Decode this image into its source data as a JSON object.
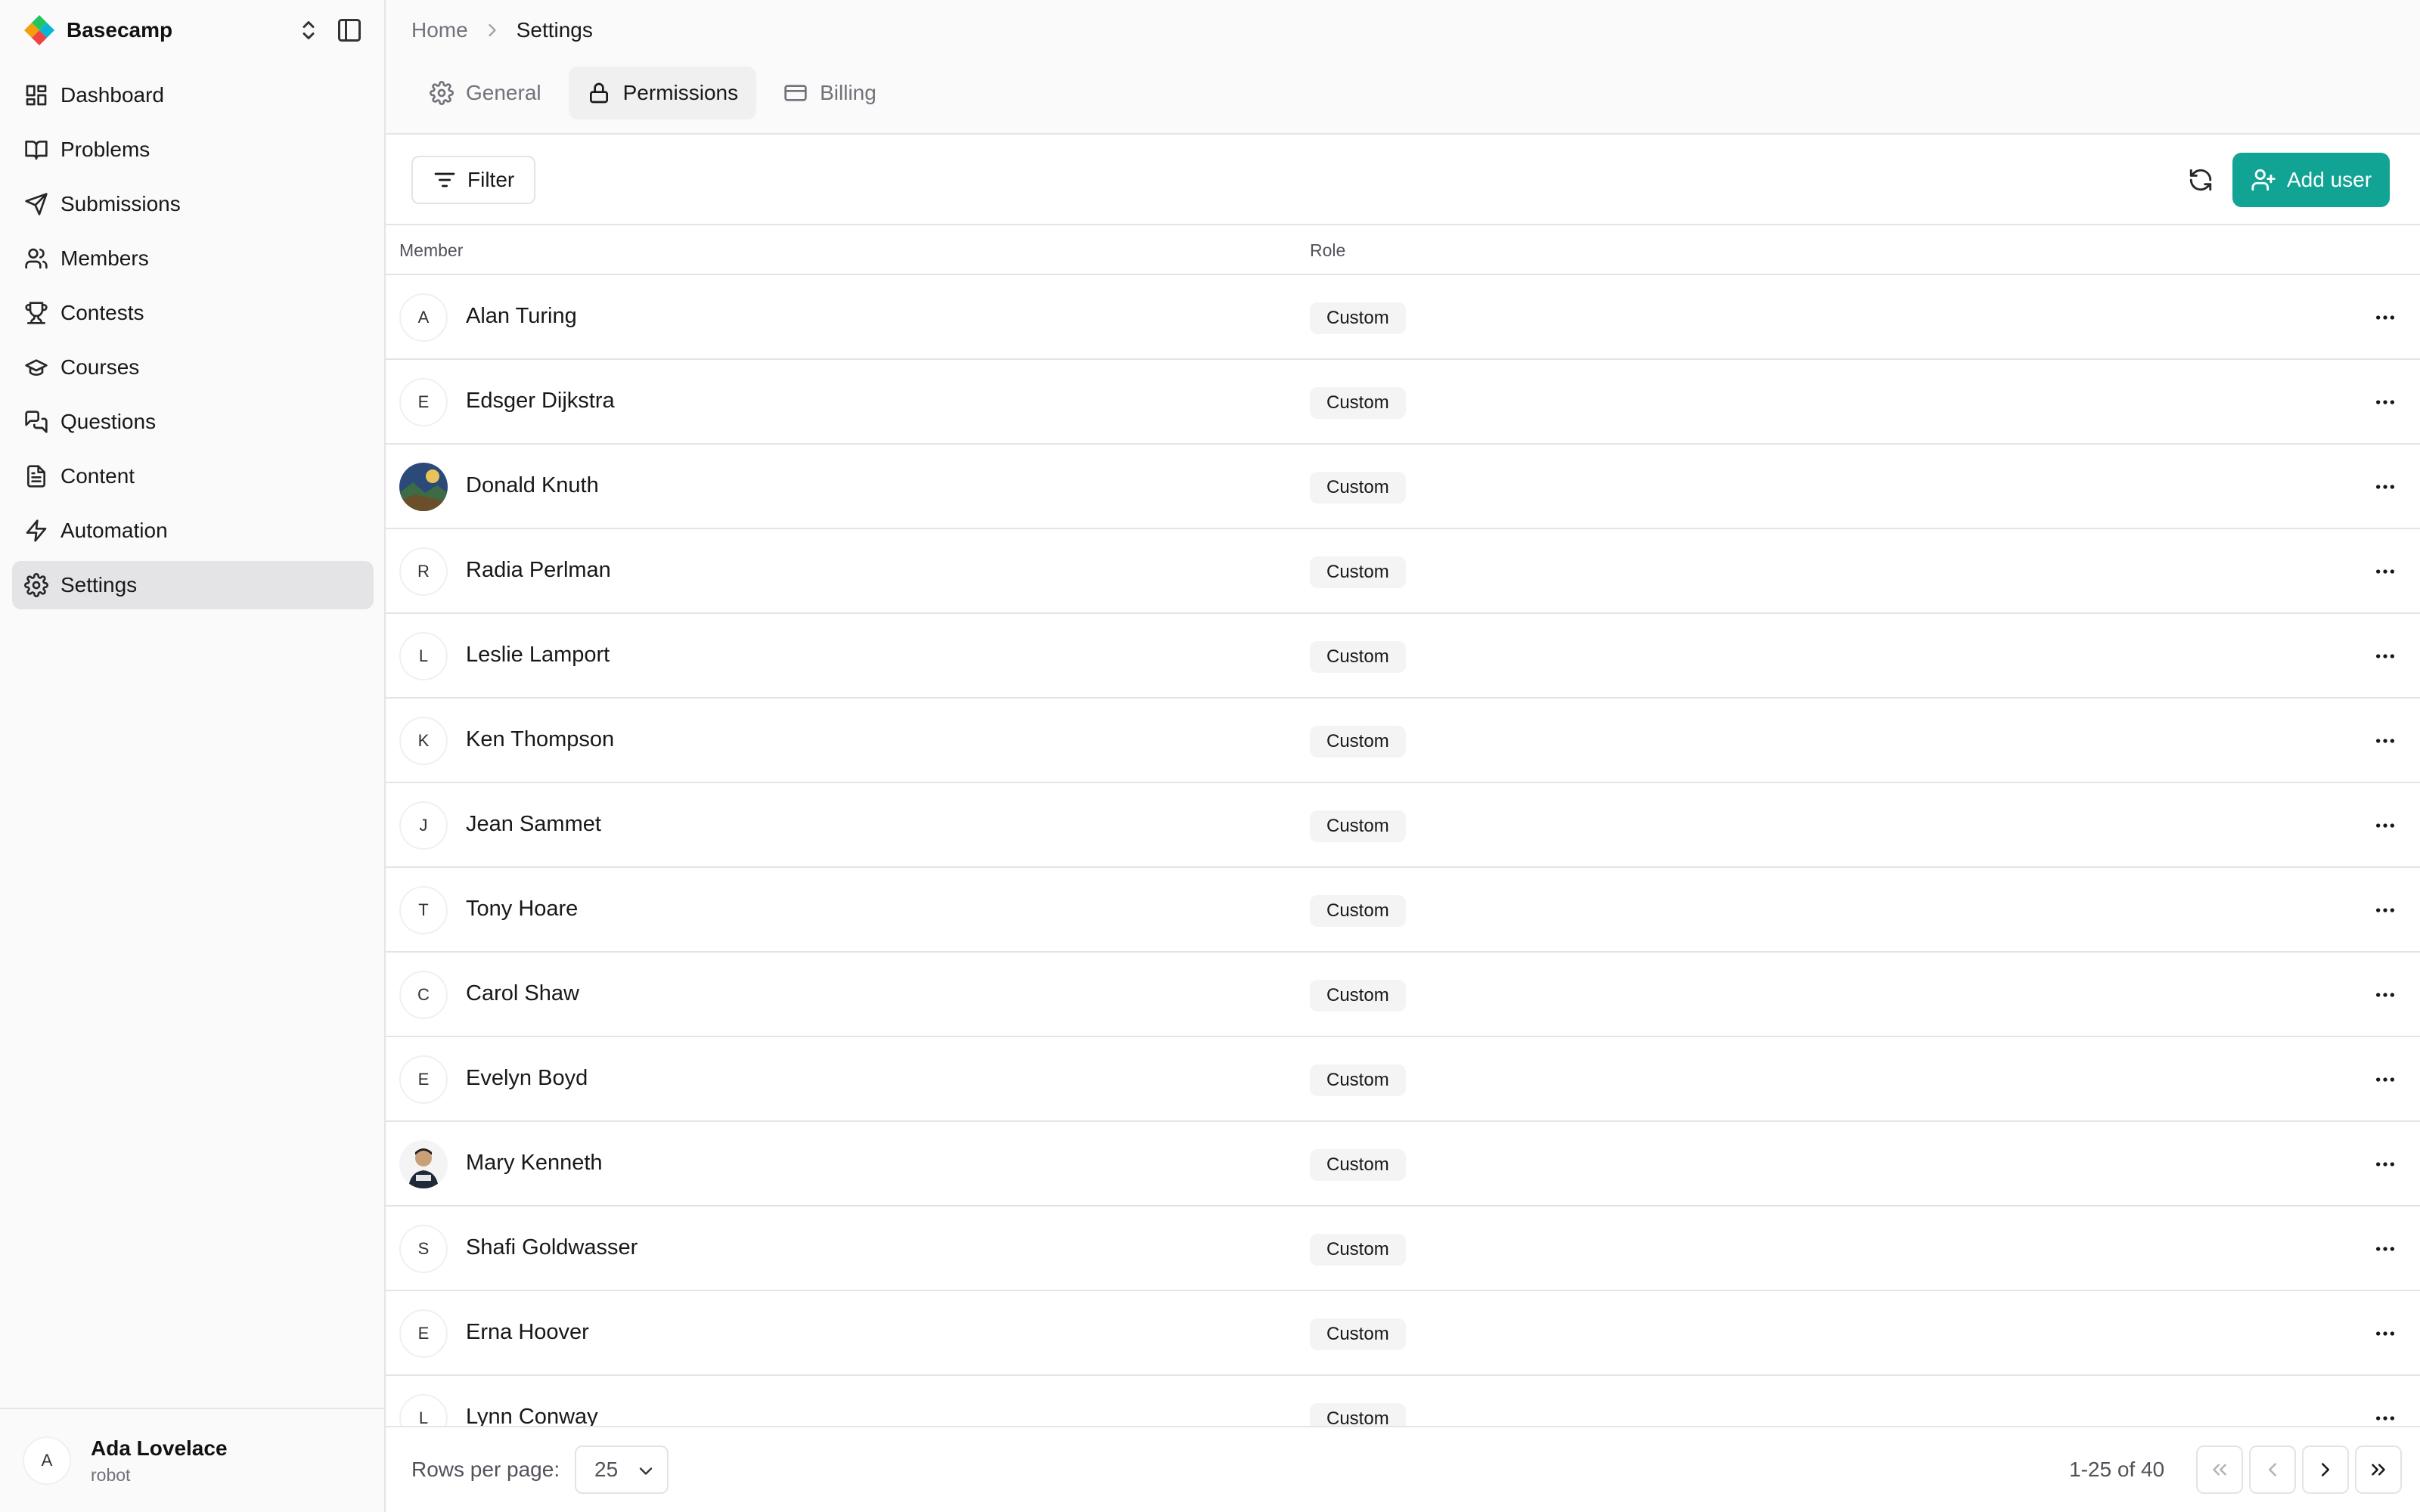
{
  "app": {
    "name": "Basecamp"
  },
  "sidebar": {
    "items": [
      {
        "label": "Dashboard",
        "icon": "dashboard-icon"
      },
      {
        "label": "Problems",
        "icon": "book-icon"
      },
      {
        "label": "Submissions",
        "icon": "send-icon"
      },
      {
        "label": "Members",
        "icon": "users-icon"
      },
      {
        "label": "Contests",
        "icon": "trophy-icon"
      },
      {
        "label": "Courses",
        "icon": "graduation-cap-icon"
      },
      {
        "label": "Questions",
        "icon": "messages-icon"
      },
      {
        "label": "Content",
        "icon": "file-text-icon"
      },
      {
        "label": "Automation",
        "icon": "zap-icon"
      },
      {
        "label": "Settings",
        "icon": "gear-icon",
        "active": true
      }
    ],
    "user": {
      "initial": "A",
      "name": "Ada Lovelace",
      "role": "robot"
    }
  },
  "breadcrumb": {
    "home": "Home",
    "current": "Settings"
  },
  "tabs": [
    {
      "label": "General",
      "icon": "gear-icon"
    },
    {
      "label": "Permissions",
      "icon": "lock-icon",
      "active": true
    },
    {
      "label": "Billing",
      "icon": "credit-card-icon"
    }
  ],
  "toolbar": {
    "filter_label": "Filter",
    "add_user_label": "Add user",
    "accent": "#11a393"
  },
  "table": {
    "columns": {
      "member": "Member",
      "role": "Role"
    },
    "rows": [
      {
        "initial": "A",
        "name": "Alan Turing",
        "role": "Custom"
      },
      {
        "initial": "E",
        "name": "Edsger Dijkstra",
        "role": "Custom"
      },
      {
        "initial": "",
        "name": "Donald Knuth",
        "role": "Custom",
        "photo": "landscape"
      },
      {
        "initial": "R",
        "name": "Radia Perlman",
        "role": "Custom"
      },
      {
        "initial": "L",
        "name": "Leslie Lamport",
        "role": "Custom"
      },
      {
        "initial": "K",
        "name": "Ken Thompson",
        "role": "Custom"
      },
      {
        "initial": "J",
        "name": "Jean Sammet",
        "role": "Custom"
      },
      {
        "initial": "T",
        "name": "Tony Hoare",
        "role": "Custom"
      },
      {
        "initial": "C",
        "name": "Carol Shaw",
        "role": "Custom"
      },
      {
        "initial": "E",
        "name": "Evelyn Boyd",
        "role": "Custom"
      },
      {
        "initial": "",
        "name": "Mary Kenneth",
        "role": "Custom",
        "photo": "person"
      },
      {
        "initial": "S",
        "name": "Shafi Goldwasser",
        "role": "Custom"
      },
      {
        "initial": "E",
        "name": "Erna Hoover",
        "role": "Custom"
      },
      {
        "initial": "L",
        "name": "Lynn Conway",
        "role": "Custom"
      }
    ]
  },
  "pagination": {
    "rows_per_page_label": "Rows per page:",
    "rows_per_page": "25",
    "range_text": "1-25 of 40"
  }
}
